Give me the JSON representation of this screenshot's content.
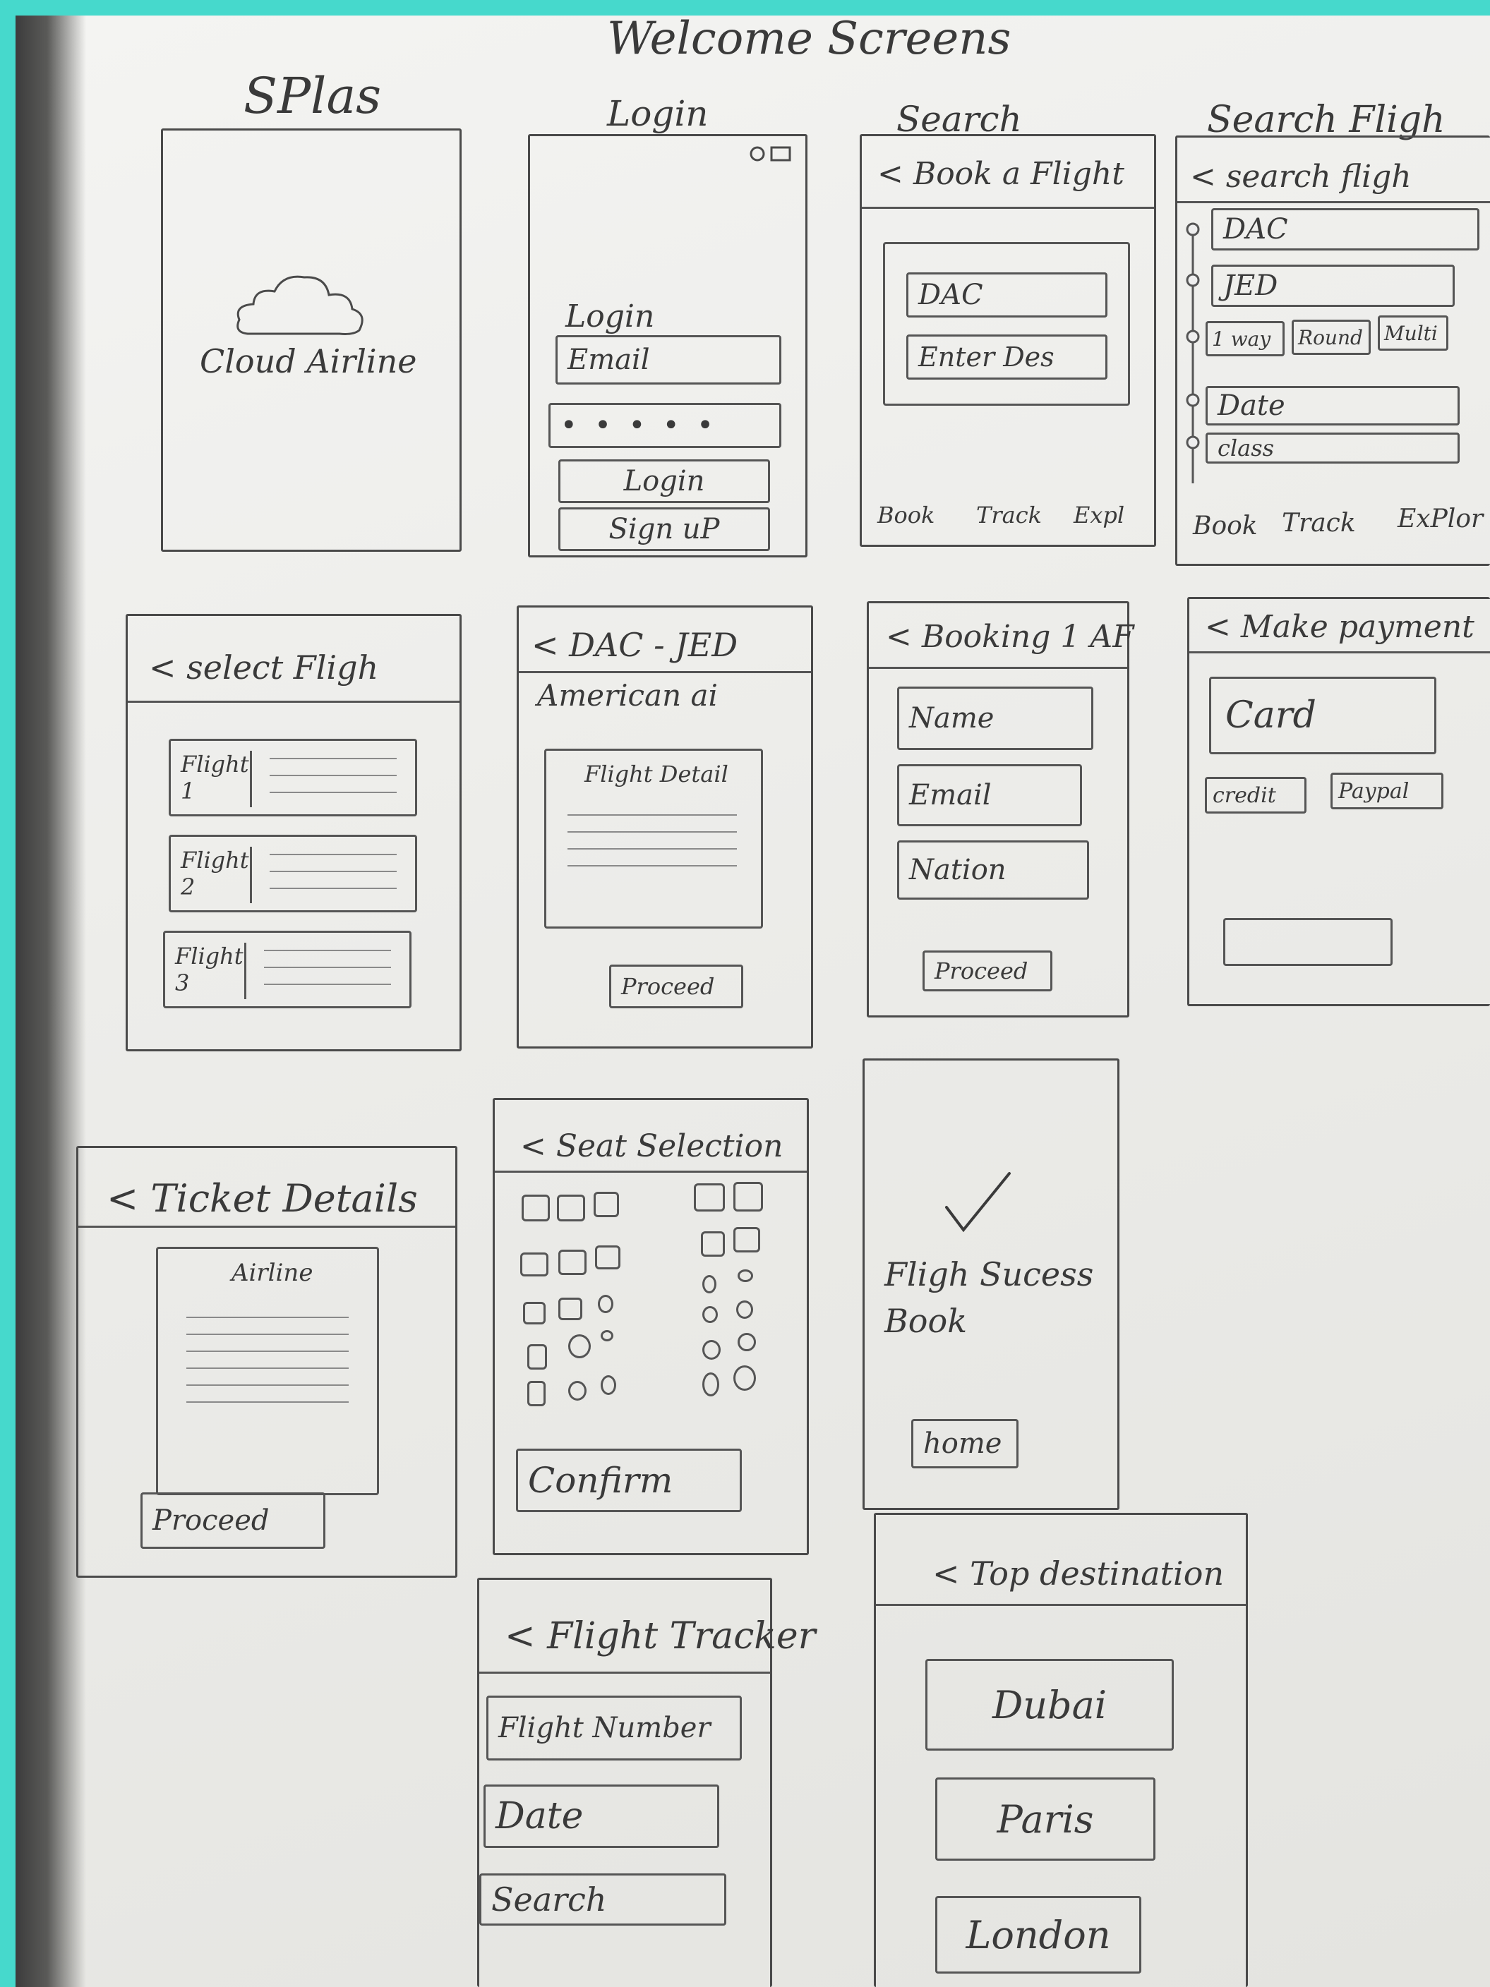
{
  "sheet": {
    "heading": "Welcome Screens",
    "background_color": "#46d9cc"
  },
  "screens": {
    "splash": {
      "caption": "SPlas",
      "logo_text": "Cloud Airline",
      "icon": "cloud-icon"
    },
    "login": {
      "caption": "Login",
      "form_title": "Login",
      "email_field": "Email",
      "password_field": "• • • • •",
      "login_button": "Login",
      "signup_button": "Sign uP",
      "status_icons": "status-icons"
    },
    "search": {
      "caption": "Search",
      "header": "< Book a Flight",
      "from_field": "DAC",
      "to_field": "Enter Des",
      "nav": [
        "Book",
        "Track",
        "Expl"
      ]
    },
    "search_flight": {
      "caption": "Search Fligh",
      "header": "< search fligh",
      "from_field": "DAC",
      "to_field": "JED",
      "trip_options": [
        "1 way",
        "Round",
        "Multi"
      ],
      "date_field": "Date",
      "class_field": "class",
      "nav": [
        "Book",
        "Track",
        "ExPlor"
      ]
    },
    "select_flight": {
      "header": "< select Fligh",
      "flights": [
        {
          "label": "Flight 1"
        },
        {
          "label": "Flight 2"
        },
        {
          "label": "Flight 3"
        }
      ]
    },
    "flight_detail": {
      "header": "< DAC - JED",
      "airline": "American ai",
      "card_title": "Flight Detail",
      "proceed_button": "Proceed"
    },
    "booking": {
      "header": "< Booking 1 AF",
      "name_field": "Name",
      "email_field": "Email",
      "nation_field": "Nation",
      "proceed_button": "Proceed"
    },
    "payment": {
      "header": "< Make payment",
      "card_field": "Card",
      "options": [
        "credit",
        "Paypal"
      ]
    },
    "ticket_details": {
      "header": "< Ticket Details",
      "airline": "Airline",
      "proceed_button": "Proceed"
    },
    "seat_selection": {
      "header": "< Seat Selection",
      "confirm_button": "Confirm"
    },
    "success": {
      "message": "Fligh Sucess Book",
      "home_button": "home",
      "icon": "check-icon"
    },
    "flight_tracker": {
      "header": "< Flight Tracker",
      "flight_number_field": "Flight Number",
      "date_field": "Date",
      "search_button": "Search"
    },
    "top_destination": {
      "header": "< Top destination",
      "destinations": [
        "Dubai",
        "Paris",
        "London"
      ]
    }
  }
}
